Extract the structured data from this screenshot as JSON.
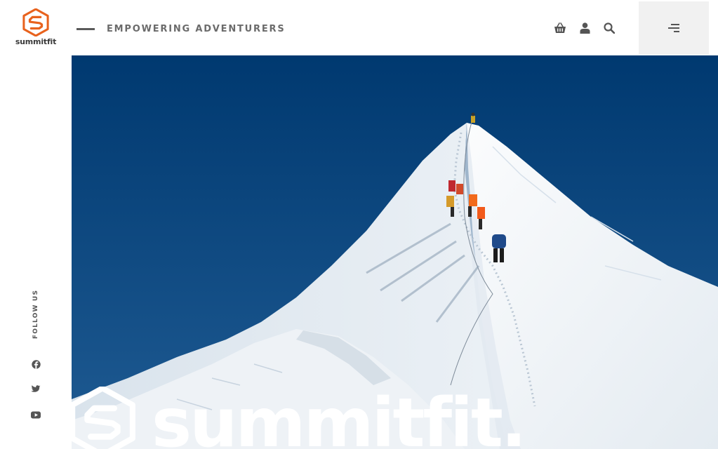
{
  "header": {
    "logo_text": "summitfit",
    "tagline": "EMPOWERING ADVENTURERS",
    "icons": [
      "basket-icon",
      "user-icon",
      "search-icon",
      "menu-icon"
    ]
  },
  "social": {
    "follow_label": "FOLLOW US",
    "icons": [
      "facebook-icon",
      "twitter-icon",
      "youtube-icon"
    ]
  },
  "hero": {
    "brand_text": "summitfit."
  },
  "colors": {
    "brand_orange": "#e8621d",
    "sky": "#0d3f73",
    "icon_grey": "#555555"
  }
}
